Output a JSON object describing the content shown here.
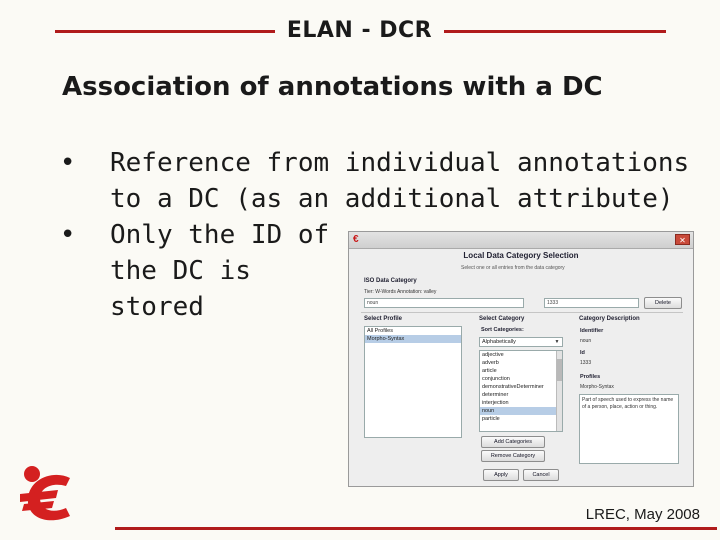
{
  "header": {
    "title": "ELAN - DCR"
  },
  "slide": {
    "title": "Association of annotations with a DC"
  },
  "bullets": [
    {
      "line1": "Reference from individual annotations",
      "line2": "to a DC (as an additional attribute)"
    },
    {
      "line1": "Only the ID of",
      "line2": "the DC is",
      "line3": "stored"
    }
  ],
  "dialog": {
    "title": "Local Data Category Selection",
    "subtitle": "Select one or all entries from the data category",
    "iso_label": "ISO Data Category",
    "tier_line": "Tier: W-Words    Annotation: valley",
    "field_left": "noun",
    "field_mid": "1333",
    "delete_button": "Delete",
    "profile_label": "Select Profile",
    "profiles": [
      "All Profiles",
      "Morpho-Syntax"
    ],
    "category_label": "Select Category",
    "sort_label": "Sort Categories:",
    "sort_value": "Alphabetically",
    "categories": [
      "adjective",
      "adverb",
      "article",
      "conjunction",
      "demonstrativeDeterminer",
      "determiner",
      "interjection",
      "noun",
      "particle"
    ],
    "add_button": "Add Categories",
    "remove_button": "Remove Category",
    "desc_label": "Category Description",
    "identifier_label": "Identifier",
    "identifier_value": "noun",
    "id_label": "Id",
    "id_value": "1333",
    "profiles_label": "Profiles",
    "profiles_value": "Morpho-Syntax",
    "description": "Part of speech used to express the name of a person, place, action or thing.",
    "apply_button": "Apply",
    "cancel_button": "Cancel"
  },
  "footer": {
    "text": "LREC, May 2008"
  },
  "colors": {
    "accent": "#b01b1b",
    "selection": "#b7cde6"
  },
  "icons": {
    "logo": "elan-logo",
    "close": "close-icon"
  }
}
